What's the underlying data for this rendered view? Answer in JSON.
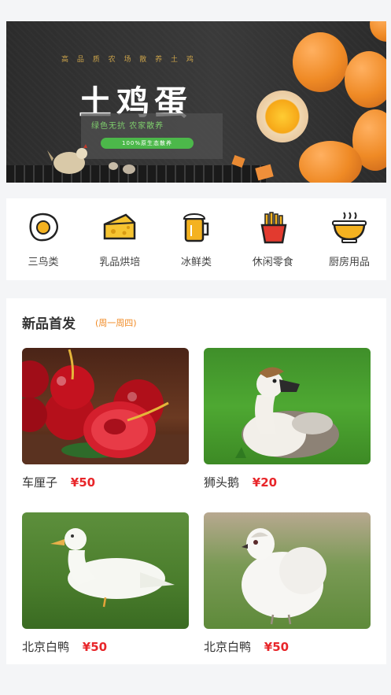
{
  "banner": {
    "tagline": "高 品 质 农 场 散 养 土 鸡",
    "title": "土鸡蛋",
    "subtitle": "绿色无抗  农家散养",
    "pill": "100%原生态散养",
    "accent": "#4cb84a"
  },
  "categories": [
    {
      "label": "三鸟类",
      "icon": "fried-egg-icon"
    },
    {
      "label": "乳品烘培",
      "icon": "cheese-icon"
    },
    {
      "label": "冰鲜类",
      "icon": "beer-icon"
    },
    {
      "label": "休闲零食",
      "icon": "fries-icon"
    },
    {
      "label": "厨房用品",
      "icon": "bowl-icon"
    }
  ],
  "new_products": {
    "title": "新品首发",
    "subtitle": "(周一周四)",
    "items": [
      {
        "name": "车厘子",
        "price": "¥50"
      },
      {
        "name": "狮头鹅",
        "price": "¥20"
      },
      {
        "name": "北京白鸭",
        "price": "¥50"
      },
      {
        "name": "北京白鸭",
        "price": "¥50"
      }
    ]
  },
  "colors": {
    "price": "#e8262a",
    "accent_orange": "#f08a24"
  }
}
